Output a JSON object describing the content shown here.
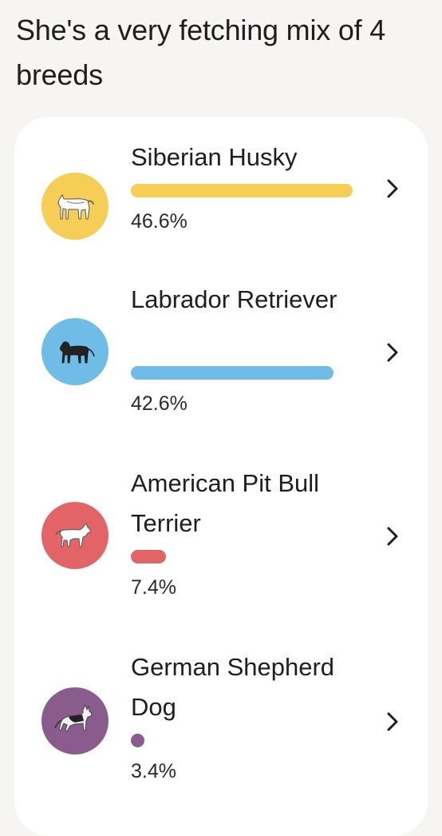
{
  "heading": "She's a very fetching mix of 4 breeds",
  "breeds": [
    {
      "name": "Siberian Husky",
      "percent_label": "46.6%",
      "percent": 46.6,
      "color": "#f6ce55",
      "icon": "husky-dog-icon"
    },
    {
      "name": "Labrador Retriever",
      "percent_label": "42.6%",
      "percent": 42.6,
      "color": "#6fbde6",
      "icon": "labrador-dog-icon"
    },
    {
      "name": "American Pit Bull Terrier",
      "percent_label": "7.4%",
      "percent": 7.4,
      "color": "#e36466",
      "icon": "pit-bull-dog-icon"
    },
    {
      "name": "German Shepherd Dog",
      "percent_label": "3.4%",
      "percent": 3.4,
      "color": "#8a5c8d",
      "icon": "german-shepherd-dog-icon"
    }
  ],
  "icons": {
    "chevron": "chevron-right-icon"
  }
}
